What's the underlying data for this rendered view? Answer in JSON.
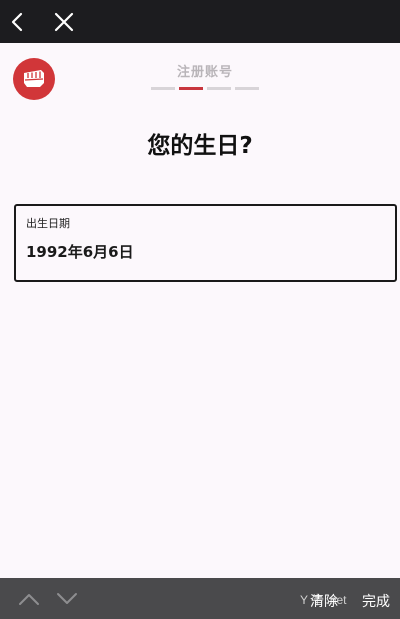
{
  "header": {
    "step_title": "注册账号",
    "progress": {
      "total_steps": 4,
      "current_step": 2
    }
  },
  "main": {
    "heading": "您的生日?",
    "birthday_field": {
      "label": "出生日期",
      "value": "1992年6月6日"
    }
  },
  "accessory_bar": {
    "watermark": "Y 牛 .net",
    "clear_label": "清除",
    "done_label": "完成"
  },
  "colors": {
    "brand": "#d13639",
    "progress_active": "#c8363e",
    "progress_inactive": "#d8d4d8",
    "background": "#fcf8fc",
    "topbar": "#1c1c1f",
    "accessory_bar": "#4a4a4c"
  },
  "icons": {
    "back": "chevron-left-icon",
    "close": "close-icon",
    "logo": "riot-fist-logo",
    "prev": "chevron-up-icon",
    "next": "chevron-down-icon"
  }
}
